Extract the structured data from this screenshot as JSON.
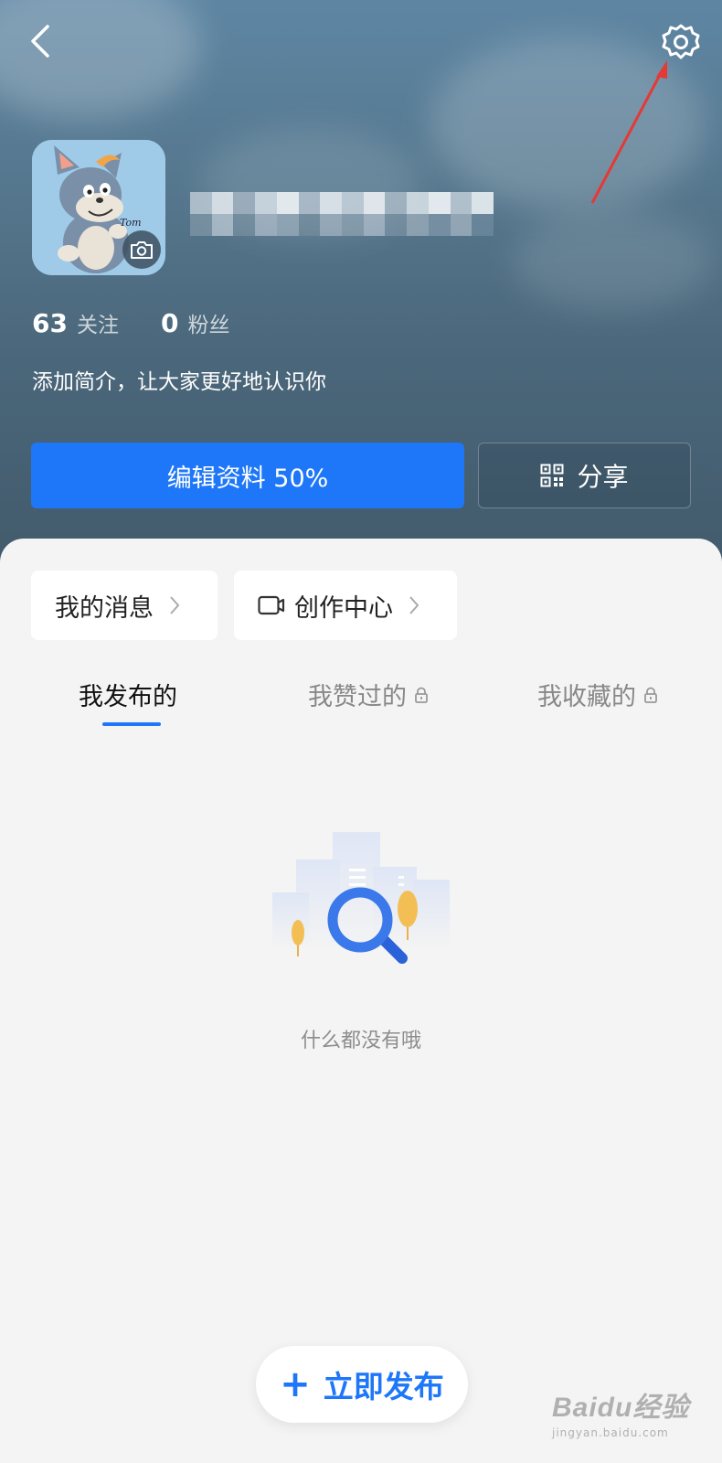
{
  "header": {
    "stats": [
      {
        "count": "63",
        "label": "关注"
      },
      {
        "count": "0",
        "label": "粉丝"
      }
    ],
    "bio": "添加简介，让大家更好地认识你",
    "edit_button": "编辑资料 50%",
    "share_button": "分享"
  },
  "quick_cards": [
    {
      "label": "我的消息"
    },
    {
      "label": "创作中心"
    }
  ],
  "tabs": [
    {
      "label": "我发布的",
      "active": true,
      "locked": false
    },
    {
      "label": "我赞过的",
      "active": false,
      "locked": true
    },
    {
      "label": "我收藏的",
      "active": false,
      "locked": true
    }
  ],
  "empty_state": {
    "text": "什么都没有哦"
  },
  "publish_button": {
    "label": "立即发布"
  },
  "watermark": {
    "logo": "Baidu经验",
    "sub": "jingyan.baidu.com"
  },
  "colors": {
    "accent": "#1e77f8",
    "annotation": "#e53935"
  }
}
